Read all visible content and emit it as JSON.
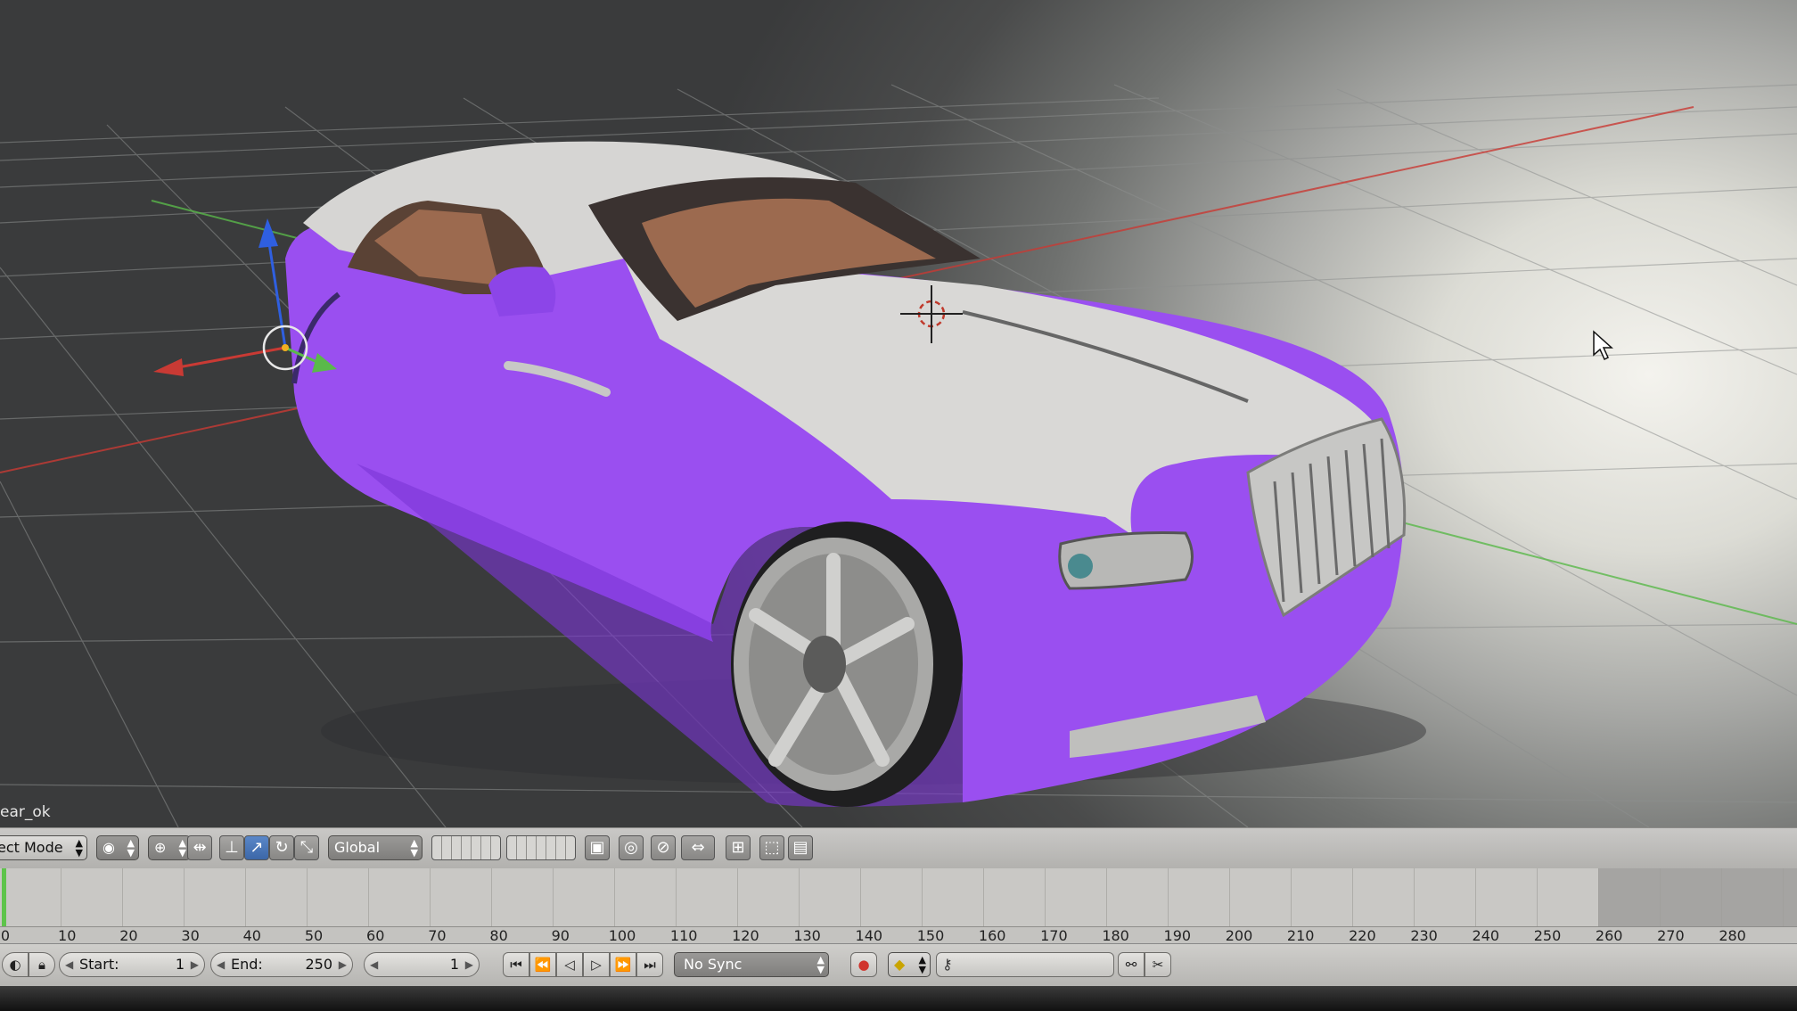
{
  "viewport": {
    "object_name": "ear_ok"
  },
  "header": {
    "mode_label": "ect Mode",
    "orientation_label": "Global",
    "icons": [
      "viewport-shading-icon",
      "pivot-icon",
      "manipulator-icon",
      "translate-icon",
      "rotate-icon",
      "scale-icon",
      "layers-icon",
      "lock-camera-icon",
      "proportional-edit-icon",
      "snap-icon",
      "snap-element-icon",
      "render-icon",
      "render-anim-icon"
    ]
  },
  "timeline": {
    "ruler_ticks": [
      "0",
      "10",
      "20",
      "30",
      "40",
      "50",
      "60",
      "70",
      "80",
      "90",
      "100",
      "110",
      "120",
      "130",
      "140",
      "150",
      "160",
      "170",
      "180",
      "190",
      "200",
      "210",
      "220",
      "230",
      "240",
      "250",
      "260",
      "270",
      "280"
    ],
    "current_frame_fraction": 0
  },
  "footer": {
    "start_label": "Start:",
    "start_value": "1",
    "end_label": "End:",
    "end_value": "250",
    "current_frame": "1",
    "sync_label": "No Sync"
  },
  "colors": {
    "car_body": "#9a4ff0",
    "car_roof": "#d9d8d6",
    "interior": "#9c6a4f",
    "axis_x": "#c93a34",
    "axis_y": "#5ab94a",
    "axis_z": "#2f5fe0"
  }
}
